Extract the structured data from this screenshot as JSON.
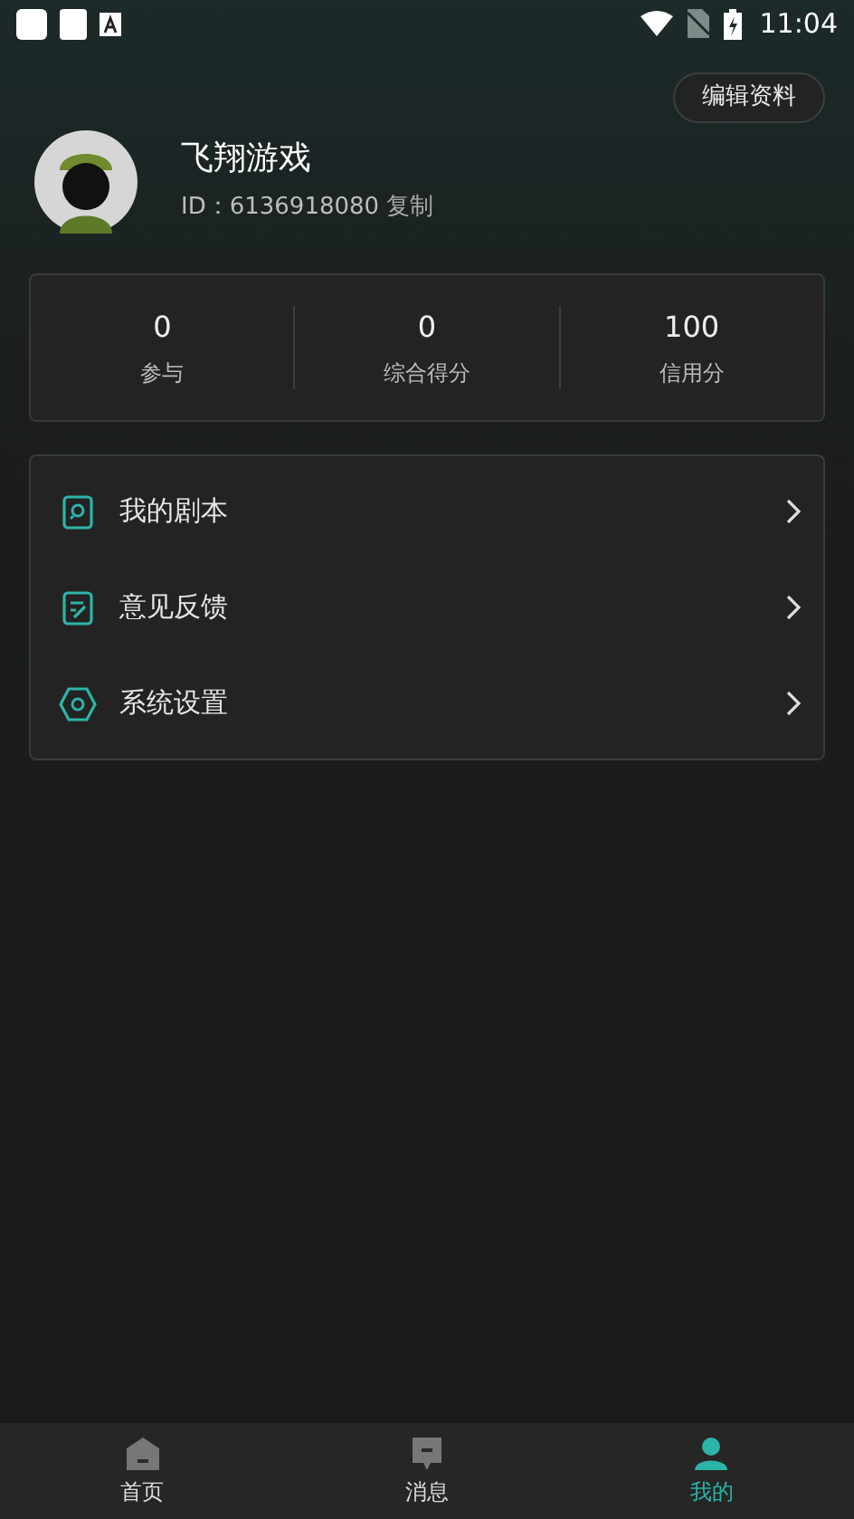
{
  "status_bar": {
    "time": "11:04"
  },
  "edit_button": "编辑资料",
  "profile": {
    "name": "飞翔游戏",
    "id": "ID：6136918080",
    "copy": "复制"
  },
  "stats": [
    {
      "value": "0",
      "label": "参与"
    },
    {
      "value": "0",
      "label": "综合得分"
    },
    {
      "value": "100",
      "label": "信用分"
    }
  ],
  "menu": [
    {
      "kind": "script",
      "label": "我的剧本"
    },
    {
      "kind": "feedback",
      "label": "意见反馈"
    },
    {
      "kind": "settings",
      "label": "系统设置"
    }
  ],
  "tabs": [
    {
      "kind": "home",
      "label": "首页",
      "selected": false
    },
    {
      "kind": "message",
      "label": "消息",
      "selected": false
    },
    {
      "kind": "me",
      "label": "我的",
      "selected": true
    }
  ]
}
